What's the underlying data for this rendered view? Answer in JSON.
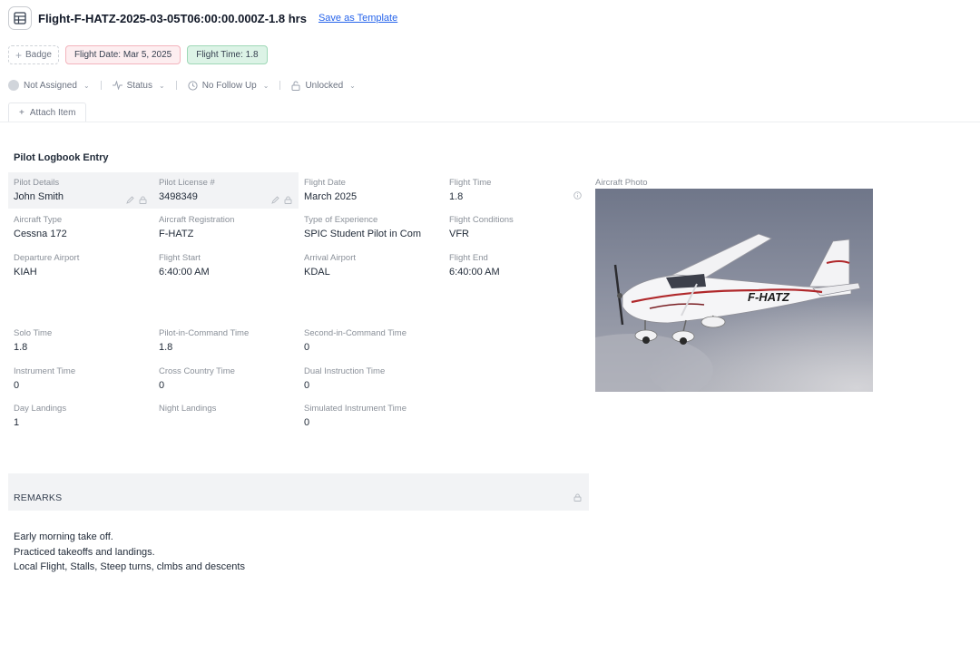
{
  "header": {
    "title": "Flight-F-HATZ-2025-03-05T06:00:00.000Z-1.8 hrs",
    "save_template": "Save as Template"
  },
  "badges": {
    "add_label": "Badge",
    "flight_date": "Flight Date: Mar 5, 2025",
    "flight_time": "Flight Time: 1.8"
  },
  "status_bar": {
    "assignee": "Not Assigned",
    "status": "Status",
    "follow_up": "No Follow Up",
    "lock": "Unlocked"
  },
  "attach_label": "Attach Item",
  "section_title": "Pilot Logbook Entry",
  "fields": {
    "pilot_details": {
      "label": "Pilot Details",
      "value": "John Smith"
    },
    "pilot_license": {
      "label": "Pilot License #",
      "value": "3498349"
    },
    "flight_date": {
      "label": "Flight Date",
      "value": "March 2025"
    },
    "flight_time": {
      "label": "Flight Time",
      "value": "1.8"
    },
    "aircraft_type": {
      "label": "Aircraft Type",
      "value": "Cessna 172"
    },
    "aircraft_registration": {
      "label": "Aircraft Registration",
      "value": "F-HATZ"
    },
    "type_of_experience": {
      "label": "Type of Experience",
      "value": "SPIC Student Pilot in Com"
    },
    "flight_conditions": {
      "label": "Flight Conditions",
      "value": "VFR"
    },
    "departure_airport": {
      "label": "Departure Airport",
      "value": "KIAH"
    },
    "flight_start": {
      "label": "Flight Start",
      "value": "6:40:00 AM"
    },
    "arrival_airport": {
      "label": "Arrival Airport",
      "value": "KDAL"
    },
    "flight_end": {
      "label": "Flight End",
      "value": "6:40:00 AM"
    },
    "solo_time": {
      "label": "Solo Time",
      "value": "1.8"
    },
    "pic_time": {
      "label": "Pilot-in-Command Time",
      "value": "1.8"
    },
    "sic_time": {
      "label": "Second-in-Command Time",
      "value": "0"
    },
    "instrument_time": {
      "label": "Instrument Time",
      "value": "0"
    },
    "cross_country_time": {
      "label": "Cross Country Time",
      "value": "0"
    },
    "dual_instruction_time": {
      "label": "Dual Instruction Time",
      "value": "0"
    },
    "day_landings": {
      "label": "Day Landings",
      "value": "1"
    },
    "night_landings": {
      "label": "Night Landings",
      "value": ""
    },
    "simulated_instrument_time": {
      "label": "Simulated Instrument Time",
      "value": "0"
    }
  },
  "photo": {
    "label": "Aircraft Photo",
    "registration_mark": "F-HATZ"
  },
  "remarks": {
    "title": "REMARKS",
    "lines": [
      "Early morning take off.",
      "Practiced takeoffs and landings.",
      "Local Flight, Stalls, Steep turns, clmbs and descents"
    ]
  }
}
